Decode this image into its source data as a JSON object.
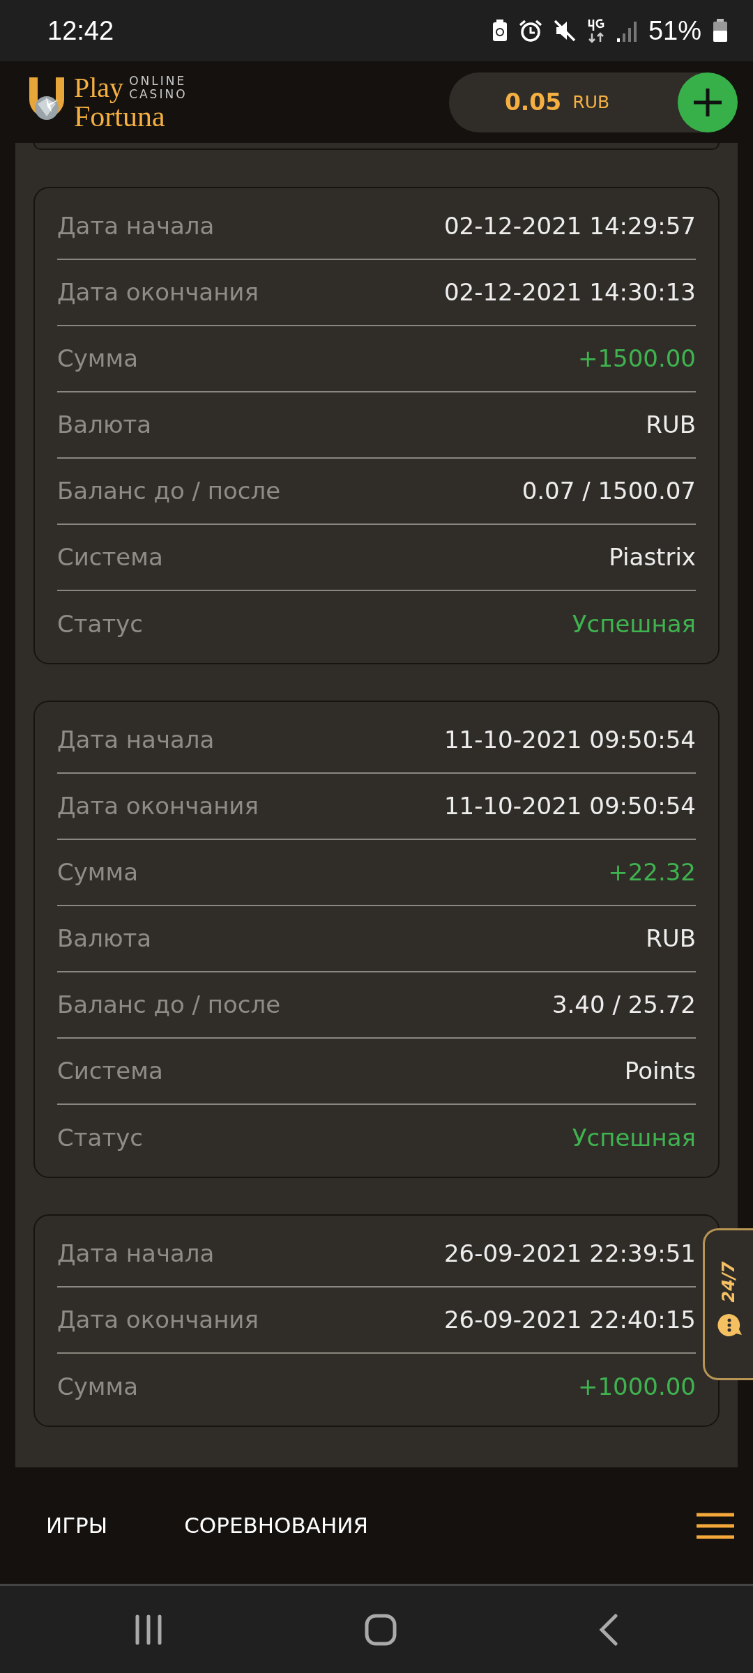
{
  "status_bar": {
    "time": "12:42",
    "battery": "51%"
  },
  "header": {
    "logo": {
      "play": "Play",
      "online": "ONLINE",
      "casino": "CASINO",
      "fortuna": "Fortuna"
    },
    "balance": {
      "amount": "0.05",
      "currency": "RUB"
    }
  },
  "transactions": [
    {
      "rows": [
        {
          "label": "Дата начала",
          "value": "02-12-2021 14:29:57",
          "highlight": false
        },
        {
          "label": "Дата окончания",
          "value": "02-12-2021 14:30:13",
          "highlight": false
        },
        {
          "label": "Сумма",
          "value": "+1500.00",
          "highlight": true
        },
        {
          "label": "Валюта",
          "value": "RUB",
          "highlight": false
        },
        {
          "label": "Баланс до / после",
          "value": "0.07 / 1500.07",
          "highlight": false
        },
        {
          "label": "Система",
          "value": "Piastrix",
          "highlight": false
        },
        {
          "label": "Статус",
          "value": "Успешная",
          "highlight": true
        }
      ]
    },
    {
      "rows": [
        {
          "label": "Дата начала",
          "value": "11-10-2021 09:50:54",
          "highlight": false
        },
        {
          "label": "Дата окончания",
          "value": "11-10-2021 09:50:54",
          "highlight": false
        },
        {
          "label": "Сумма",
          "value": "+22.32",
          "highlight": true
        },
        {
          "label": "Валюта",
          "value": "RUB",
          "highlight": false
        },
        {
          "label": "Баланс до / после",
          "value": "3.40 / 25.72",
          "highlight": false
        },
        {
          "label": "Система",
          "value": "Points",
          "highlight": false
        },
        {
          "label": "Статус",
          "value": "Успешная",
          "highlight": true
        }
      ]
    },
    {
      "rows": [
        {
          "label": "Дата начала",
          "value": "26-09-2021 22:39:51",
          "highlight": false
        },
        {
          "label": "Дата окончания",
          "value": "26-09-2021 22:40:15",
          "highlight": false
        },
        {
          "label": "Сумма",
          "value": "+1000.00",
          "highlight": true
        }
      ]
    }
  ],
  "support_tab": {
    "label": "24/7"
  },
  "bottom_nav": {
    "items": [
      {
        "label": "ИГРЫ"
      },
      {
        "label": "СОРЕВНОВАНИЯ"
      }
    ]
  }
}
